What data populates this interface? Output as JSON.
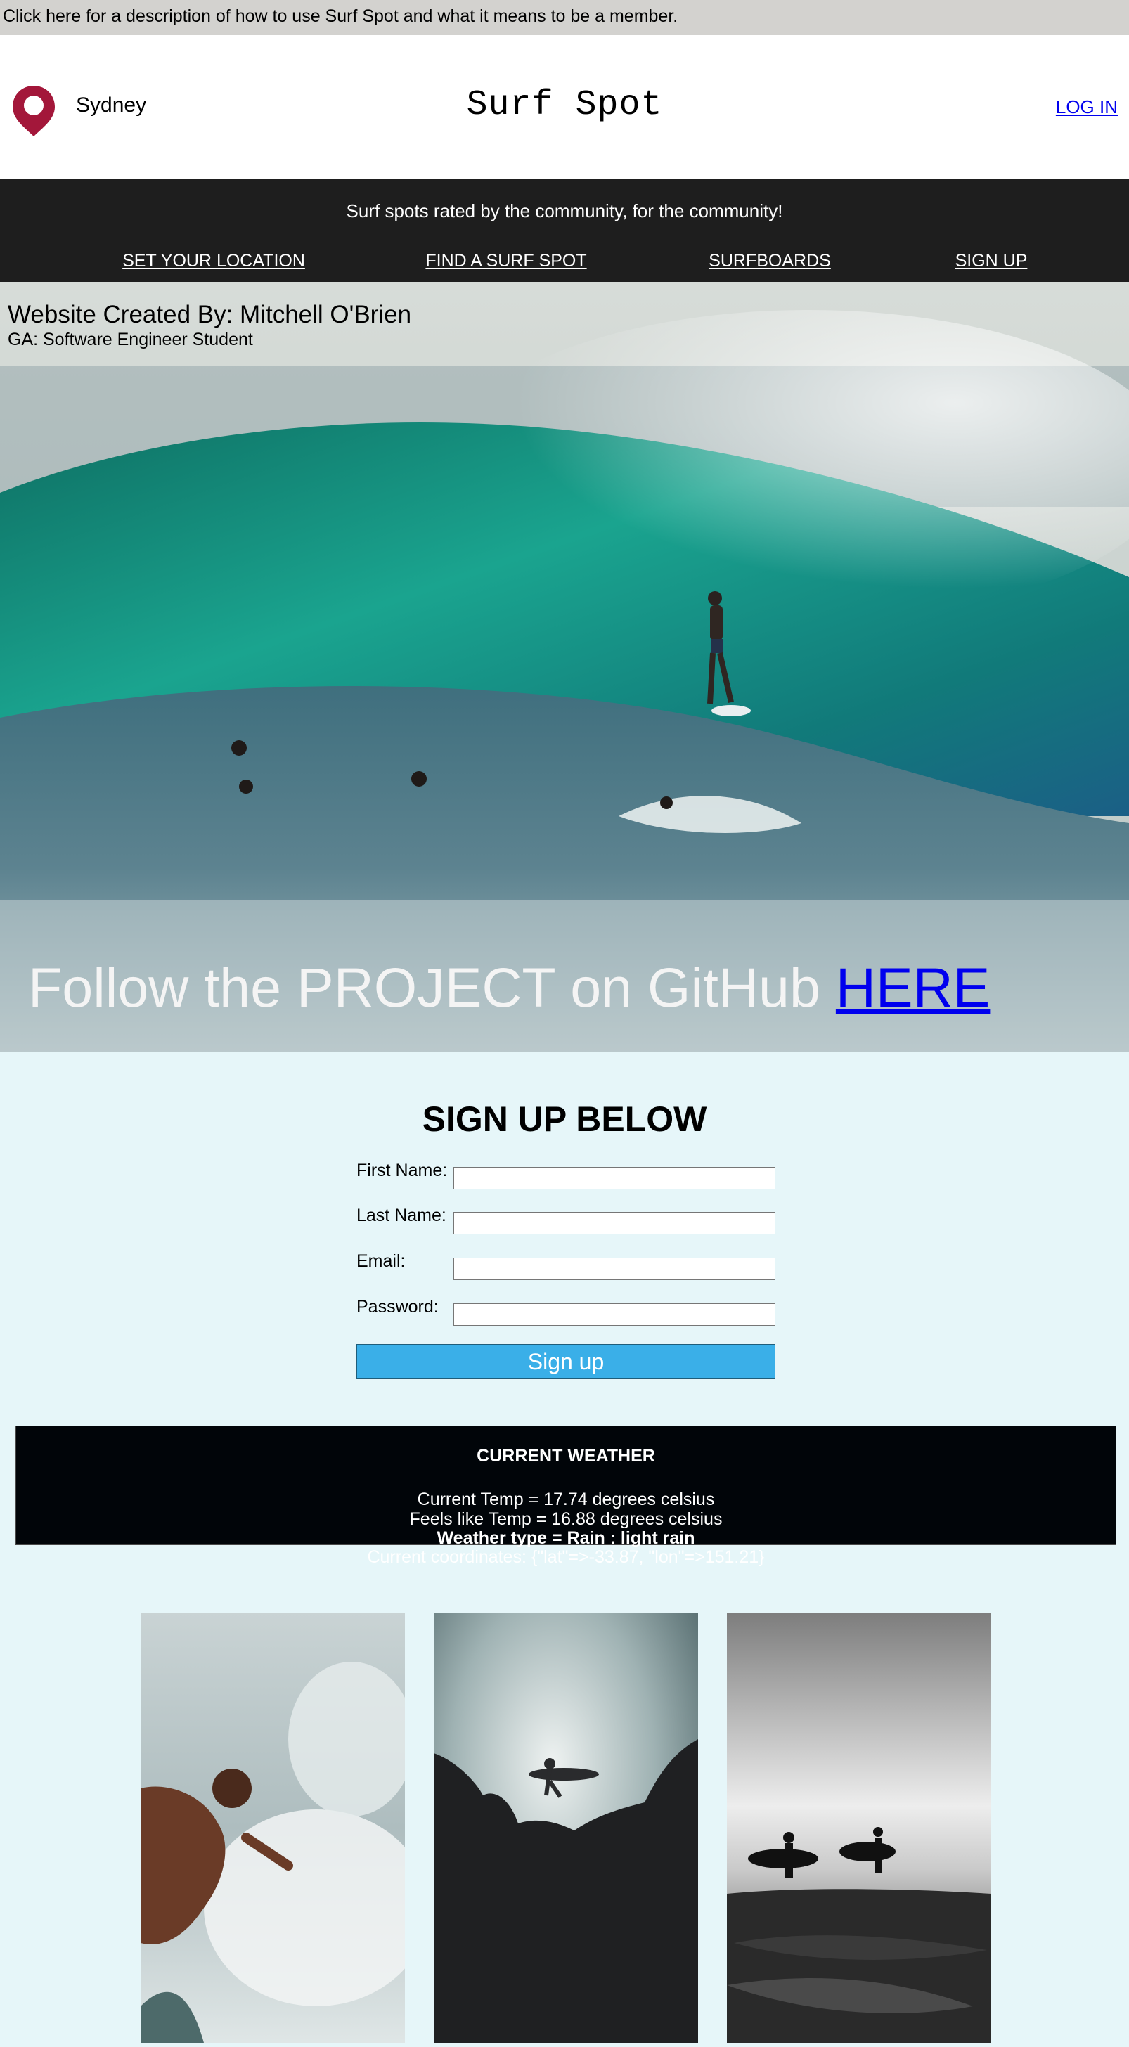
{
  "info_banner": {
    "text": "Click here for a description of how to use Surf Spot and what it means to be a member."
  },
  "header": {
    "location": "Sydney",
    "title": "Surf Spot",
    "login": "LOG IN",
    "icon": "map-pin-icon",
    "pin_color": "#a3173a"
  },
  "nav": {
    "tagline": "Surf spots rated by the community, for the community!",
    "items": [
      {
        "label": "SET YOUR LOCATION"
      },
      {
        "label": "FIND A SURF SPOT"
      },
      {
        "label": "SURFBOARDS"
      },
      {
        "label": "SIGN UP"
      }
    ]
  },
  "hero": {
    "credit_name": "Website Created By: Mitchell O'Brien",
    "credit_role": "GA: Software Engineer Student",
    "github_prefix": "Follow the PROJECT on GitHub",
    "github_link": "HERE"
  },
  "signup": {
    "heading": "SIGN UP BELOW",
    "fields": [
      {
        "label": "First Name:",
        "value": ""
      },
      {
        "label": "Last Name:",
        "value": ""
      },
      {
        "label": "Email:",
        "value": ""
      },
      {
        "label": "Password:",
        "value": ""
      }
    ],
    "button": "Sign up",
    "button_color": "#3aafe8"
  },
  "weather": {
    "title": "CURRENT WEATHER",
    "temp": "Current Temp = 17.74 degrees celsius",
    "feels_like": "Feels like Temp = 16.88 degrees celsius",
    "type": "Weather type = Rain : light rain",
    "coordinates": "Current coordinates: {\"lat\"=>-33.87, \"lon\"=>151.21}"
  },
  "colors": {
    "page_background": "#e6f6f9",
    "nav_background": "#1e1e1e",
    "weather_background": "#010509",
    "banner_background": "#d3d2cf"
  }
}
